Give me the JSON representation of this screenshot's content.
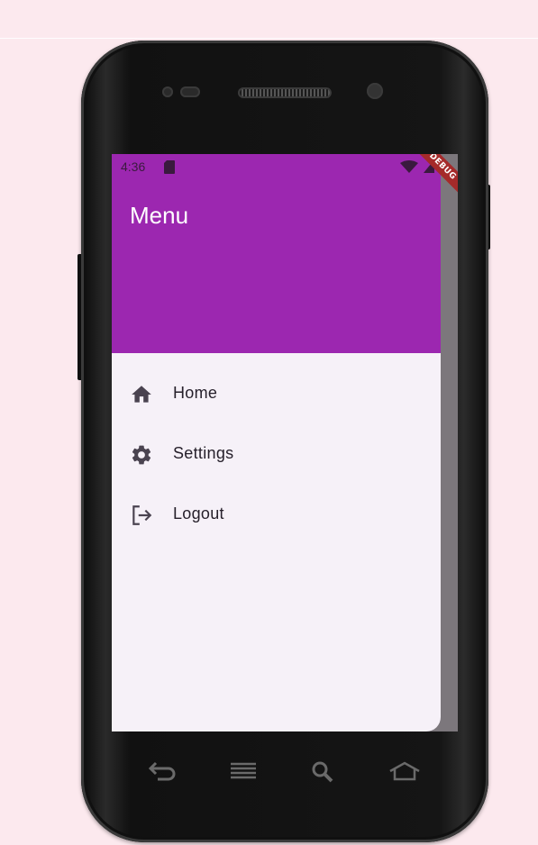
{
  "status_bar": {
    "time": "4:36",
    "icons": [
      "sd-card-icon",
      "wifi-icon",
      "signal-icon",
      "battery-icon"
    ]
  },
  "debug_banner": "DEBUG",
  "drawer": {
    "title": "Menu",
    "header_color": "#9c27b0",
    "items": [
      {
        "label": "Home",
        "icon": "home-icon"
      },
      {
        "label": "Settings",
        "icon": "gear-icon"
      },
      {
        "label": "Logout",
        "icon": "logout-icon"
      }
    ]
  },
  "device_nav": {
    "icons": [
      "back-icon",
      "menu-icon",
      "search-icon",
      "home-nav-icon"
    ]
  },
  "colors": {
    "background": "#fce9ee",
    "drawer_background": "#f6f1f8",
    "scrim": "#7c777c",
    "debug_banner": "#a52a2a"
  }
}
